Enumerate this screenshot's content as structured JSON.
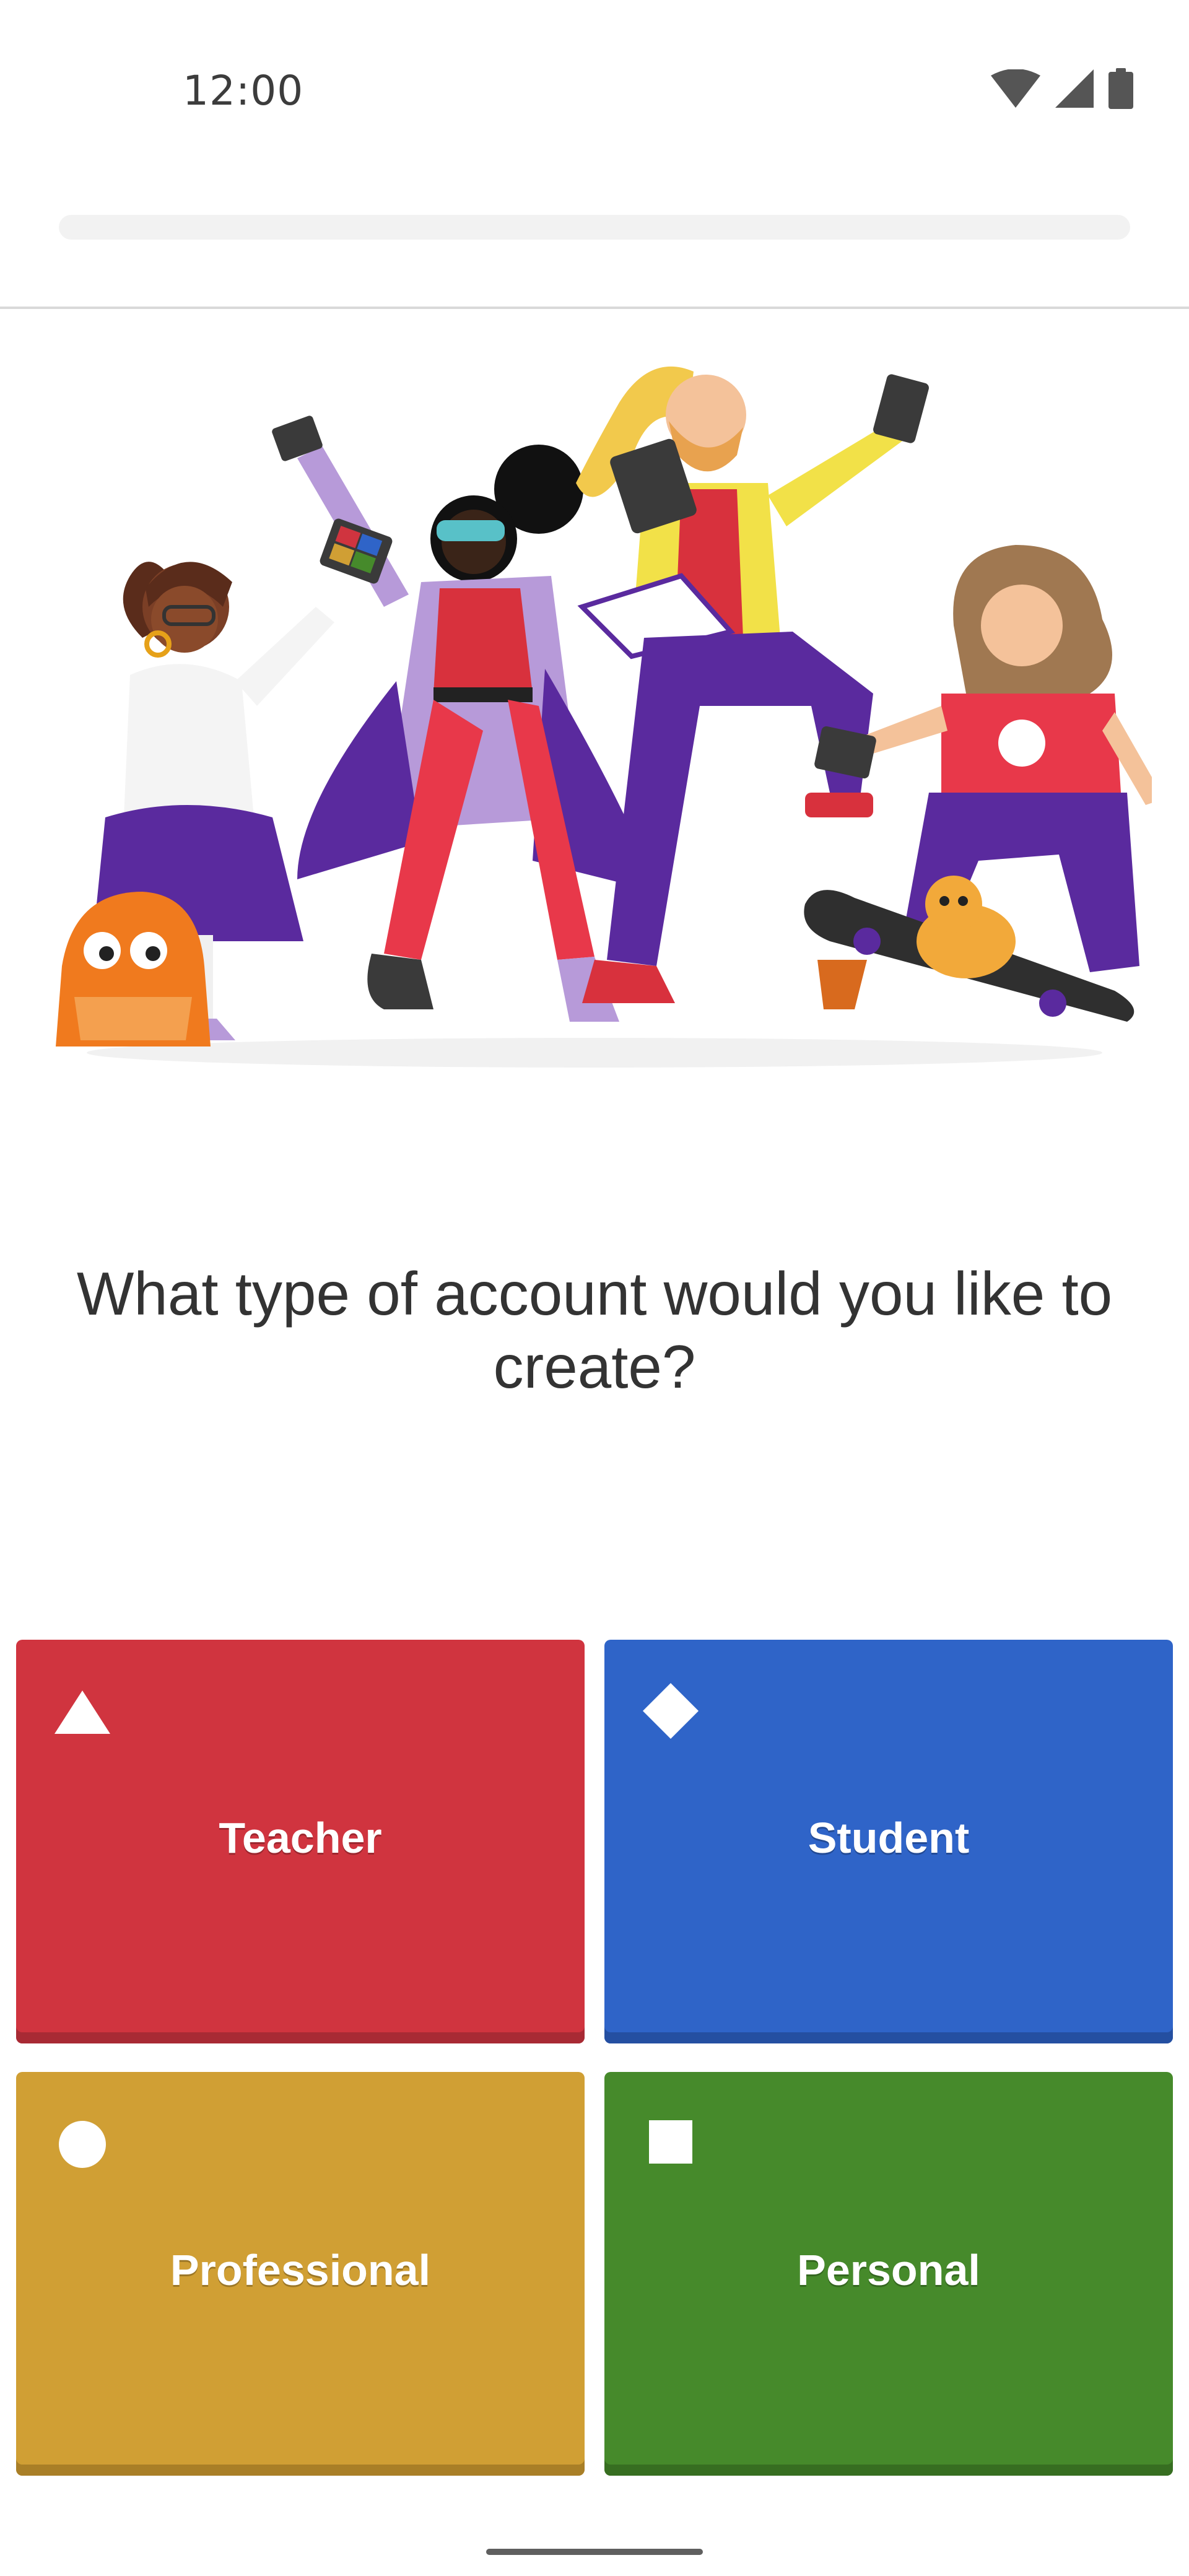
{
  "status_bar": {
    "time": "12:00",
    "icons": [
      "wifi-icon",
      "cell-signal-icon",
      "battery-icon"
    ]
  },
  "progress": {
    "fraction": 0.0
  },
  "question": "What type of account would you like to create?",
  "answers": [
    {
      "label": "Teacher",
      "shape": "triangle-icon",
      "color": "#d0343f"
    },
    {
      "label": "Student",
      "shape": "diamond-icon",
      "color": "#2f64c8"
    },
    {
      "label": "Professional",
      "shape": "circle-icon",
      "color": "#d09f34"
    },
    {
      "label": "Personal",
      "shape": "square-icon",
      "color": "#468a2b"
    }
  ],
  "colors": {
    "teacher_red": "#d0343f",
    "student_blue": "#2f64c8",
    "professional_gold": "#d09f34",
    "personal_green": "#468a2b",
    "kahoot_purple": "#46178f"
  }
}
